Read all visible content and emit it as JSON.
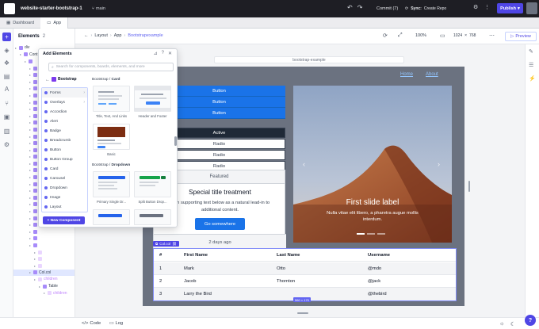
{
  "topbar": {
    "project": "website-starter-bootstrap-1",
    "branch": "main",
    "commit_label": "Commit (7)",
    "sync_label": "Sync:",
    "sync_action": "Create Repo",
    "publish_label": "Publish"
  },
  "tabs": [
    {
      "label": "Dashboard"
    },
    {
      "label": "App"
    }
  ],
  "elements_panel": {
    "title": "Elements",
    "count": "2",
    "tree": [
      {
        "label": "div",
        "indent": 0,
        "pink": false
      },
      {
        "label": "Cont",
        "indent": 1,
        "pink": false
      },
      {
        "label": "",
        "indent": 2,
        "pink": false
      },
      {
        "label": "",
        "indent": 3,
        "pink": false
      },
      {
        "label": "",
        "indent": 3,
        "pink": false
      },
      {
        "label": "",
        "indent": 3,
        "pink": false
      },
      {
        "label": "",
        "indent": 3,
        "pink": false
      },
      {
        "label": "",
        "indent": 3,
        "pink": false
      },
      {
        "label": "",
        "indent": 3,
        "pink": false
      },
      {
        "label": "",
        "indent": 3,
        "pink": false
      },
      {
        "label": "",
        "indent": 3,
        "pink": false
      },
      {
        "label": "",
        "indent": 3,
        "pink": false
      },
      {
        "label": "",
        "indent": 3,
        "pink": false
      },
      {
        "label": "",
        "indent": 3,
        "pink": false
      },
      {
        "label": "",
        "indent": 3,
        "pink": false
      },
      {
        "label": "",
        "indent": 3,
        "pink": false
      },
      {
        "label": "",
        "indent": 3,
        "pink": false
      },
      {
        "label": "",
        "indent": 3,
        "pink": false
      },
      {
        "label": "",
        "indent": 3,
        "pink": false
      },
      {
        "label": "",
        "indent": 3,
        "pink": false
      },
      {
        "label": "",
        "indent": 3,
        "pink": false
      },
      {
        "label": "",
        "indent": 3,
        "pink": false
      },
      {
        "label": "",
        "indent": 3,
        "pink": false
      },
      {
        "label": "",
        "indent": 3,
        "pink": false
      },
      {
        "label": "",
        "indent": 3,
        "pink": false
      },
      {
        "label": "",
        "indent": 3,
        "pink": false
      },
      {
        "label": "",
        "indent": 3,
        "pink": false
      },
      {
        "label": "",
        "indent": 3,
        "pink": false
      },
      {
        "label": "",
        "indent": 3,
        "pink": false
      },
      {
        "label": "",
        "indent": 3,
        "pink": false
      },
      {
        "label": "",
        "indent": 4,
        "pink": true
      },
      {
        "label": "",
        "indent": 4,
        "pink": true
      },
      {
        "label": "",
        "indent": 4,
        "pink": true
      },
      {
        "label": "Col.col",
        "indent": 3,
        "pink": false,
        "selected": true
      },
      {
        "label": "children",
        "indent": 4,
        "pink": true
      },
      {
        "label": "Table",
        "indent": 5,
        "pink": false
      },
      {
        "label": "children",
        "indent": 6,
        "pink": true
      }
    ]
  },
  "add_elements": {
    "title": "Add Elements",
    "search_placeholder": "Search for components, boards, elements, and more",
    "library": "Bootstrap",
    "categories": [
      {
        "label": "Forms",
        "chevron": true
      },
      {
        "label": "Overlays",
        "chevron": true
      },
      {
        "label": "Accordion",
        "chevron": false
      },
      {
        "label": "Alert",
        "chevron": false
      },
      {
        "label": "Badge",
        "chevron": false
      },
      {
        "label": "Breadcrumb",
        "chevron": false
      },
      {
        "label": "Button",
        "chevron": false
      },
      {
        "label": "Button Group",
        "chevron": false
      },
      {
        "label": "Card",
        "chevron": false
      },
      {
        "label": "Carousel",
        "chevron": false
      },
      {
        "label": "Dropdown",
        "chevron": false
      },
      {
        "label": "Image",
        "chevron": false
      },
      {
        "label": "Layout",
        "chevron": false
      }
    ],
    "new_component_label": "+ New Component",
    "section_card": {
      "prefix": "Bootstrap / ",
      "name": "Card"
    },
    "section_dropdown": {
      "prefix": "Bootstrap / ",
      "name": "Dropdown"
    },
    "cards": [
      {
        "label": "Title, Text, And Links"
      },
      {
        "label": "Header and Footer"
      },
      {
        "label": "Basic"
      },
      {
        "label": "Primary Single Dr..."
      },
      {
        "label": "Split Button Drop..."
      }
    ],
    "card_preview_button": "Button"
  },
  "subbar": {
    "breadcrumb": [
      "Layout",
      "App",
      "Bootstrapexample"
    ],
    "zoom": "100%",
    "width": "1024",
    "height": "768",
    "preview_label": "Preview"
  },
  "canvas": {
    "url": "bootstrap-example",
    "nav": [
      "Home",
      "About"
    ],
    "buttons": [
      "Button",
      "Button",
      "Button"
    ],
    "radios": [
      "Active",
      "Radio",
      "Radio",
      "Radio"
    ],
    "featured_card": {
      "header": "Featured",
      "title": "Special title treatment",
      "text": "With supporting text below as a natural lead-in to additional content.",
      "button": "Go somewhere",
      "footer": "2 days ago"
    },
    "carousel": {
      "title": "First slide label",
      "subtitle": "Nulla vitae elit libero, a pharetra augue mollis interdum.",
      "indicators": 3,
      "active_indicator": 0
    },
    "col_chip": "Col.col",
    "size_chip": "560 × 170",
    "table": {
      "headers": [
        "#",
        "First Name",
        "Last Name",
        "Username"
      ],
      "rows": [
        [
          "1",
          "Mark",
          "Otto",
          "@mdo"
        ],
        [
          "2",
          "Jacob",
          "Thornton",
          "@jack"
        ],
        [
          "3",
          "Larry the Bird",
          "",
          "@thebird"
        ]
      ]
    }
  },
  "bottombar": {
    "code_label": "Code",
    "log_label": "Log"
  },
  "help_label": "?",
  "colors": {
    "accent": "#4f46e5",
    "bootstrap_primary": "#1a73e8",
    "topbar": "#1e1e24"
  }
}
